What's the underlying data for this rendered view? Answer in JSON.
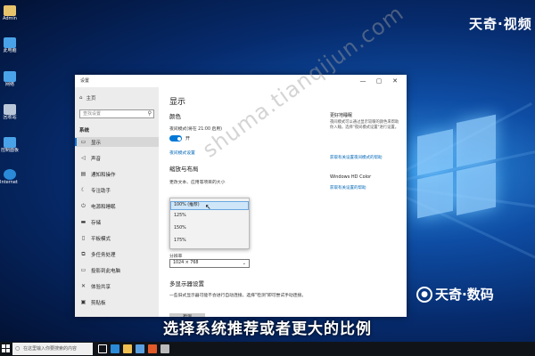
{
  "brand": {
    "top": "天奇·视频",
    "bottom_text": "天奇·数码"
  },
  "watermark": "shuma.tianqijun.com",
  "subtitle": "选择系统推荐或者更大的比例",
  "desktop_icons": [
    {
      "label": "Admin",
      "color": "#e7c36b"
    },
    {
      "label": "此电脑",
      "color": "#4aa3e8"
    },
    {
      "label": "网络",
      "color": "#4aa3e8"
    },
    {
      "label": "回收站",
      "color": "#b9c7d8"
    },
    {
      "label": "控制面板",
      "color": "#4aa3e8"
    },
    {
      "label": "Internet Explorer",
      "color": "#2a8ad8"
    }
  ],
  "window": {
    "title": "设置",
    "controls": {
      "minimize": "—",
      "maximize": "▢",
      "close": "✕"
    },
    "sidebar": {
      "home": "主页",
      "search_placeholder": "查找设置",
      "section": "系统",
      "items": [
        {
          "label": "显示",
          "icon": "monitor-icon",
          "glyph": "▭"
        },
        {
          "label": "声音",
          "icon": "speaker-icon",
          "glyph": "◁"
        },
        {
          "label": "通知和操作",
          "icon": "notification-icon",
          "glyph": "▤"
        },
        {
          "label": "专注助手",
          "icon": "moon-icon",
          "glyph": "☾"
        },
        {
          "label": "电源和睡眠",
          "icon": "power-icon",
          "glyph": "⏻"
        },
        {
          "label": "存储",
          "icon": "storage-icon",
          "glyph": "▬"
        },
        {
          "label": "平板模式",
          "icon": "tablet-icon",
          "glyph": "▯"
        },
        {
          "label": "多任务处理",
          "icon": "multitask-icon",
          "glyph": "⧉"
        },
        {
          "label": "投影到此电脑",
          "icon": "project-icon",
          "glyph": "▭"
        },
        {
          "label": "体验共享",
          "icon": "share-icon",
          "glyph": "✕"
        },
        {
          "label": "剪贴板",
          "icon": "clipboard-icon",
          "glyph": "▣"
        }
      ]
    },
    "main": {
      "title": "显示",
      "color_heading": "颜色",
      "night_light_label": "夜间模式(将在 21:00 启用)",
      "toggle_state": "开",
      "night_light_link": "夜间模式设置",
      "scale_heading": "缩放与布局",
      "scale_label": "更改文本、应用等项目的大小",
      "scale_options": [
        "100% (推荐)",
        "125%",
        "150%",
        "175%"
      ],
      "resolution_label": "分辨率",
      "resolution_value": "1024 × 768",
      "multi_heading": "多显示器设置",
      "multi_desc": "一些旧式显示器可能不会进行自动连接。选择\"检测\"即可尝试手动连接。",
      "detect_button": "检测"
    },
    "right_panel": {
      "sleep_heading": "更好地睡眠",
      "sleep_desc": "夜间模式可以通过显示较暖的颜色来帮助你入睡。选择\"夜间模式设置\"进行设置。",
      "sleep_link": "获取有关设置夜间模式的帮助",
      "hdr_heading": "Windows HD Color",
      "hdr_link": "获取有关设置的帮助"
    }
  },
  "taskbar": {
    "search_placeholder": "在这里输入你要搜索的内容",
    "icons": [
      {
        "name": "task-view-icon",
        "color": "#ffffff"
      },
      {
        "name": "edge-icon",
        "color": "#2a8ad8"
      },
      {
        "name": "explorer-icon",
        "color": "#f0c050"
      },
      {
        "name": "store-icon",
        "color": "#5aa0e0"
      },
      {
        "name": "app-icon",
        "color": "#e05a2a"
      },
      {
        "name": "settings-icon",
        "color": "#bbbbbb"
      }
    ]
  }
}
